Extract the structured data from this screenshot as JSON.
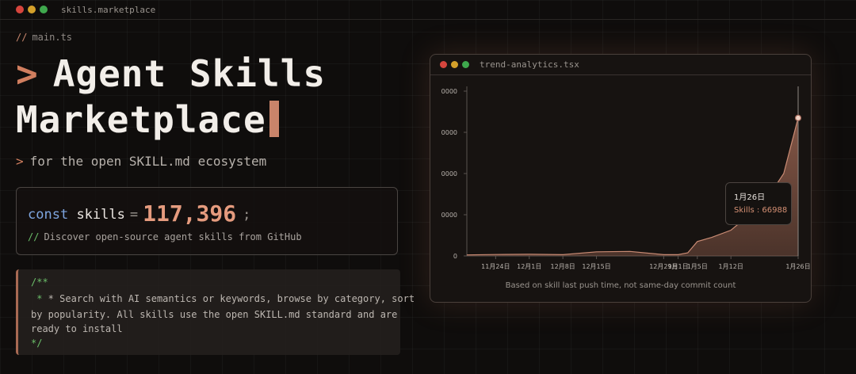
{
  "window": {
    "title": "skills.marketplace"
  },
  "hero": {
    "file_comment_prefix": "//",
    "file_comment": "main.ts",
    "prompt_symbol": ">",
    "title_line1": "Agent Skills",
    "title_line2": "Marketplace",
    "subtitle_prompt": ">",
    "subtitle": "for the open SKILL.md ecosystem"
  },
  "code_card": {
    "keyword": "const",
    "variable": "skills",
    "operator": "=",
    "value": "117,396",
    "semicolon": ";",
    "comment_prefix": "//",
    "comment": "Discover open-source agent skills from GitHub"
  },
  "doc_comment": {
    "open": "/**",
    "line1": " * Search with AI semantics or keywords, browse by category, sort",
    "line2": "by popularity. All skills use the open SKILL.md standard and are",
    "line3": "ready to install",
    "close": "*/"
  },
  "chart_window": {
    "title": "trend-analytics.tsx",
    "caption": "Based on skill last push time, not same-day commit count",
    "tooltip": {
      "date": "1月26日",
      "label": "Skills : 66988"
    }
  },
  "chart_data": {
    "type": "area",
    "title": "",
    "xlabel": "",
    "ylabel": "",
    "y_tick_labels": [
      "0",
      "0000",
      "0000",
      "0000",
      "0000"
    ],
    "x_tick_labels": [
      "11月24日",
      "12月1日",
      "12月8日",
      "12月15日",
      "12月29日",
      "1月1日",
      "1月5日",
      "1月12日",
      "1月26日"
    ],
    "ylim": [
      0,
      80000
    ],
    "series": [
      {
        "values_by_date": [
          [
            "11月18日",
            500
          ],
          [
            "11月24日",
            700
          ],
          [
            "12月1日",
            800
          ],
          [
            "12月8日",
            600
          ],
          [
            "12月15日",
            2000
          ],
          [
            "12月22日",
            2200
          ],
          [
            "12月29日",
            600
          ],
          [
            "1月1日",
            600
          ],
          [
            "1月3日",
            1500
          ],
          [
            "1月5日",
            7000
          ],
          [
            "1月8日",
            9000
          ],
          [
            "1月12日",
            12500
          ],
          [
            "1月19日",
            26000
          ],
          [
            "1月23日",
            40000
          ],
          [
            "1月26日",
            66988
          ]
        ]
      }
    ],
    "highlight": {
      "date": "1月26日",
      "value": 66988
    },
    "grid": false,
    "colors": {
      "fill": "#8a5a49",
      "line": "#c98b74",
      "point": "#f0d3c6"
    }
  }
}
